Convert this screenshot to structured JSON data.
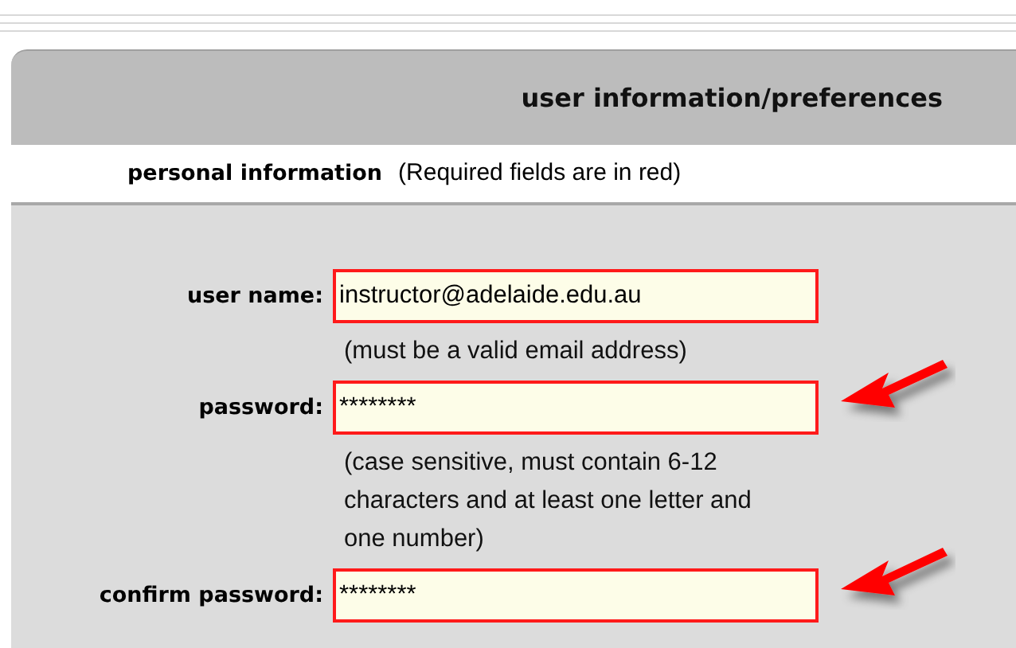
{
  "panel": {
    "title": "user information/preferences"
  },
  "section": {
    "title": "personal information",
    "note": "(Required fields are in red)"
  },
  "fields": [
    {
      "label": "user name:",
      "value": "instructor@adelaide.edu.au",
      "required": true,
      "pointer": false,
      "hint": "(must be a valid email address)"
    },
    {
      "label": "password:",
      "value": "********",
      "required": true,
      "pointer": true,
      "hint": "(case sensitive, must contain 6-12 characters and at least one letter and one number)"
    },
    {
      "label": "confirm password:",
      "value": "********",
      "required": true,
      "pointer": true
    }
  ]
}
